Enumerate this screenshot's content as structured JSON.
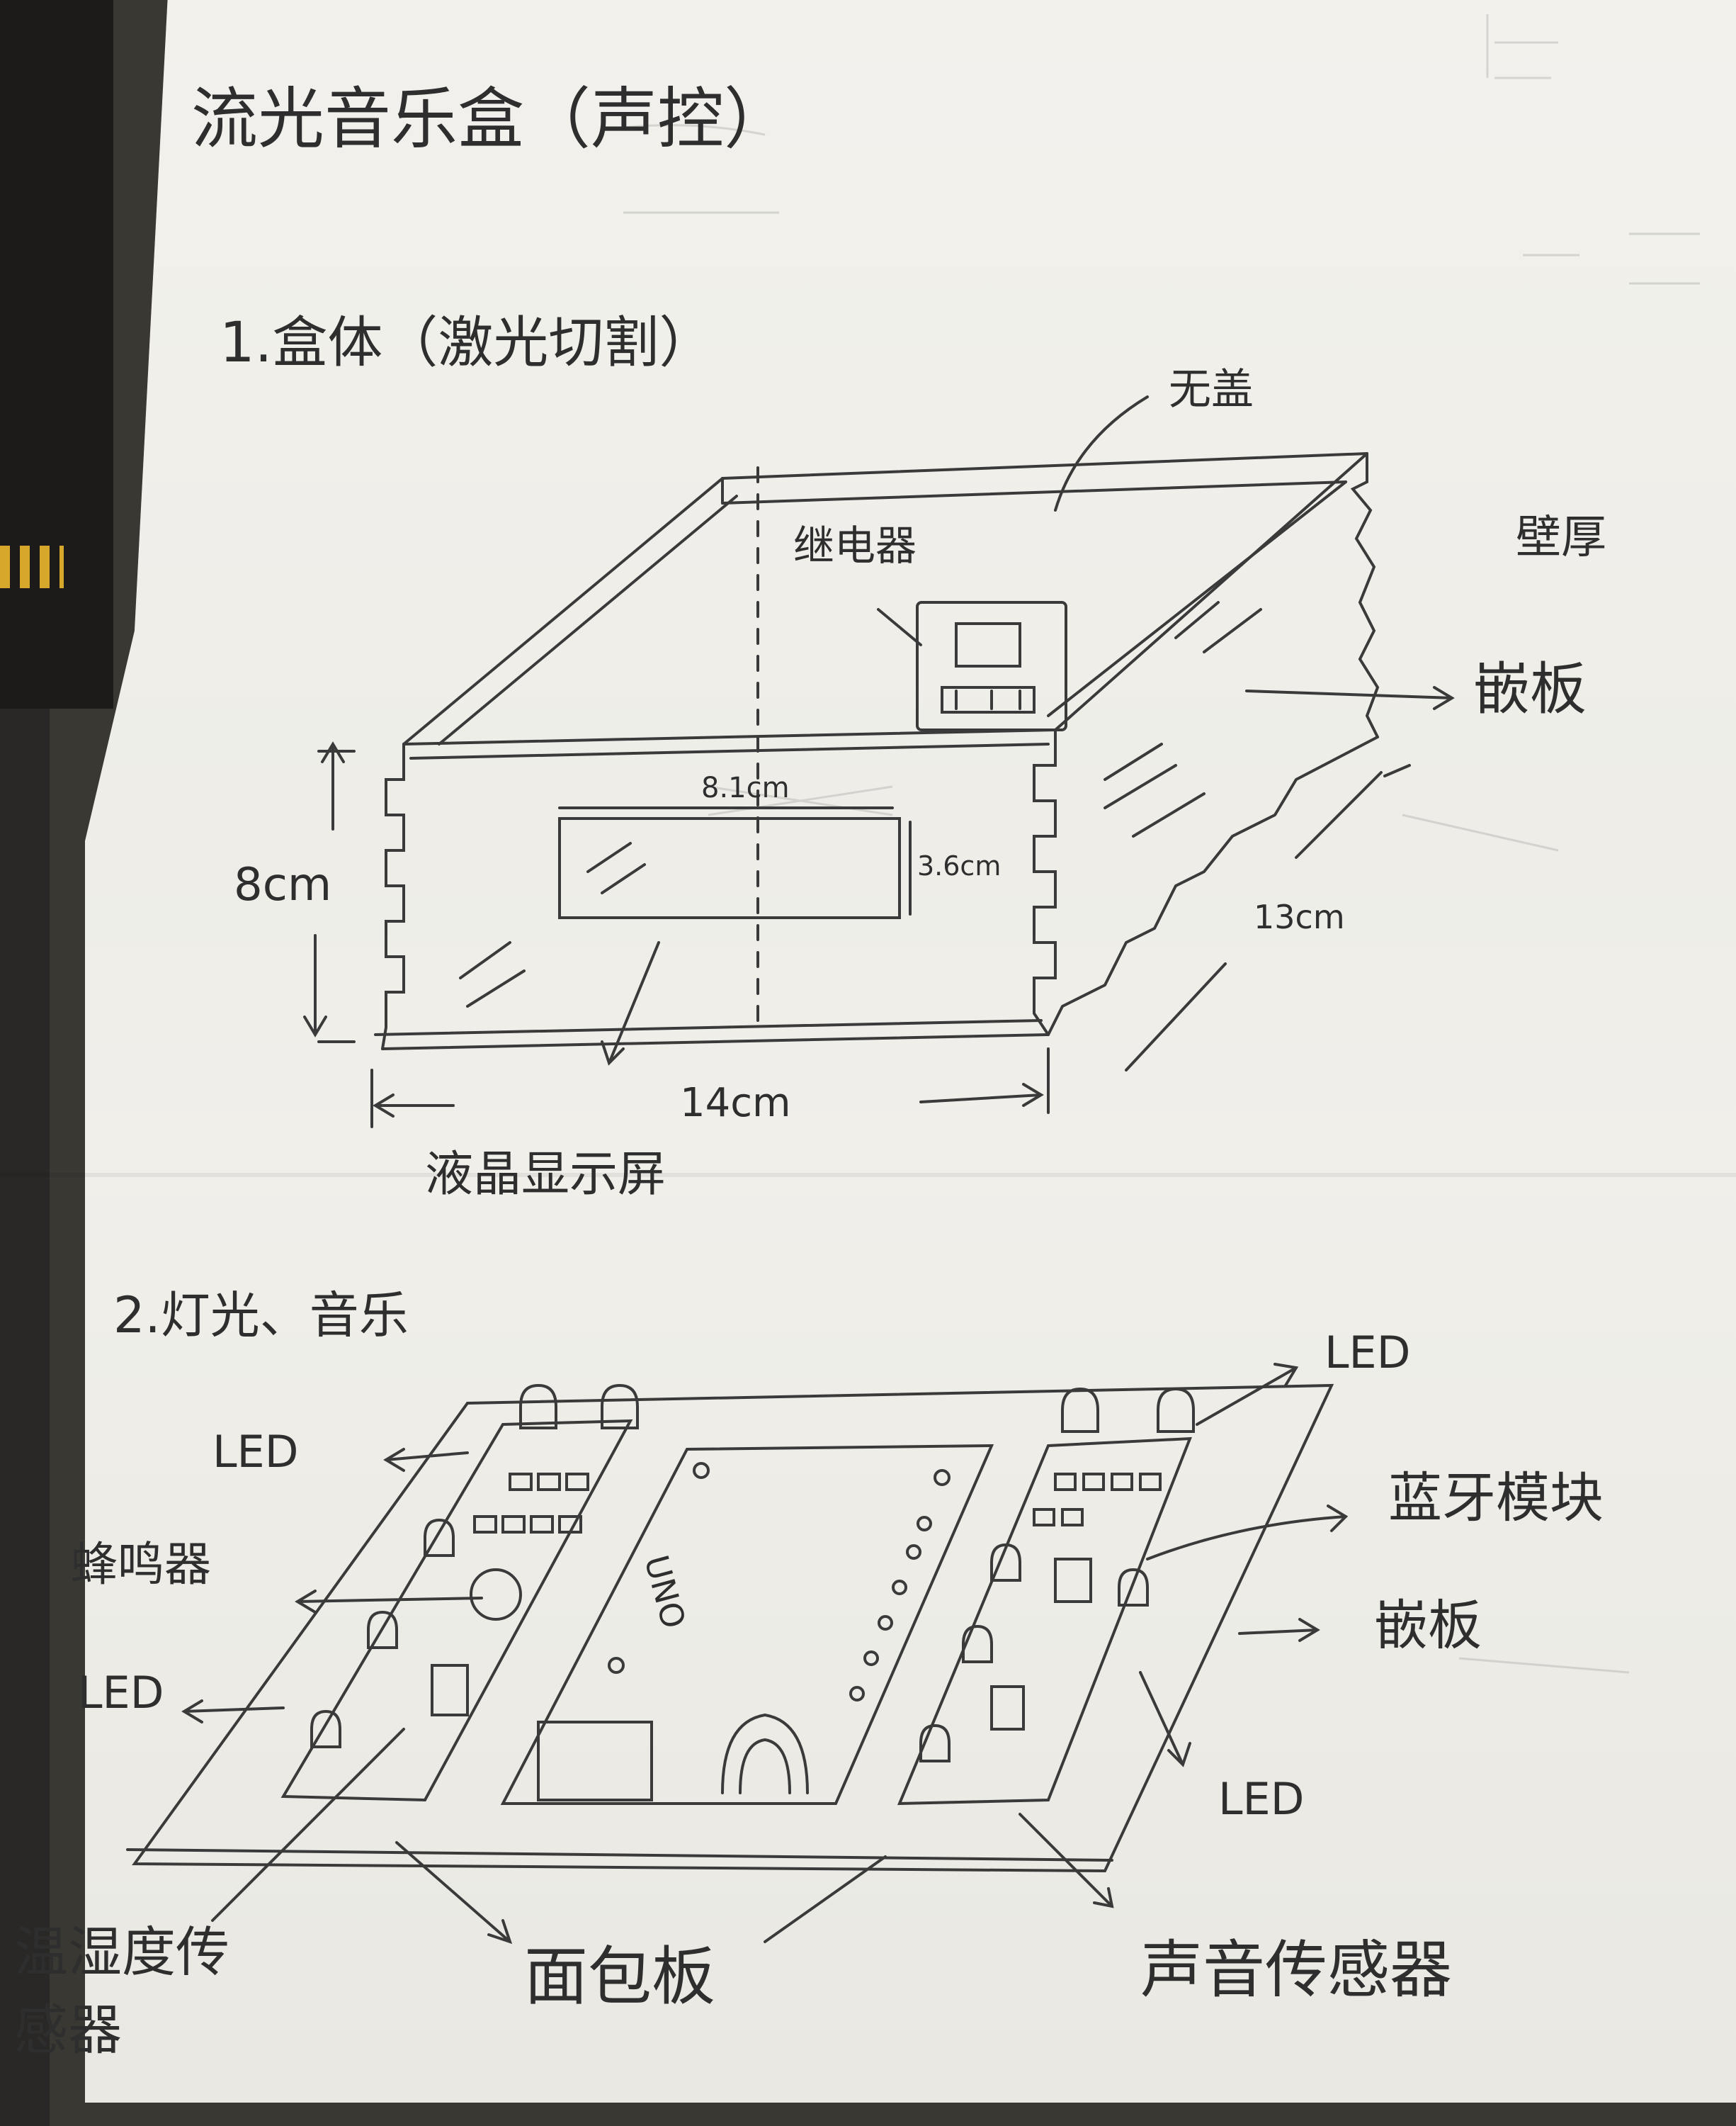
{
  "title": "流光音乐盒（声控）",
  "section1": {
    "heading": "1.盒体（激光切割）",
    "labels": {
      "lid": "无盖",
      "relay": "继电器",
      "wall_thickness": "壁厚",
      "inlay_board": "嵌板",
      "height": "8cm",
      "lcd_width": "8.1cm",
      "lcd_height": "3.6cm",
      "depth": "13cm",
      "width": "14cm",
      "lcd": "液晶显示屏"
    }
  },
  "section2": {
    "heading": "2.灯光、音乐",
    "labels": {
      "led_top_right": "LED",
      "led_left_top": "LED",
      "buzzer": "蜂鸣器",
      "led_left_bottom": "LED",
      "bluetooth": "蓝牙模块",
      "inlay_board": "嵌板",
      "led_right_bottom": "LED",
      "temp_humidity_sensor": "温湿度传感器",
      "breadboard": "面包板",
      "sound_sensor": "声音传感器",
      "uno_label": "UNO"
    }
  },
  "colors": {
    "ink": "#2e2e2e",
    "paper": "#efeee9"
  }
}
